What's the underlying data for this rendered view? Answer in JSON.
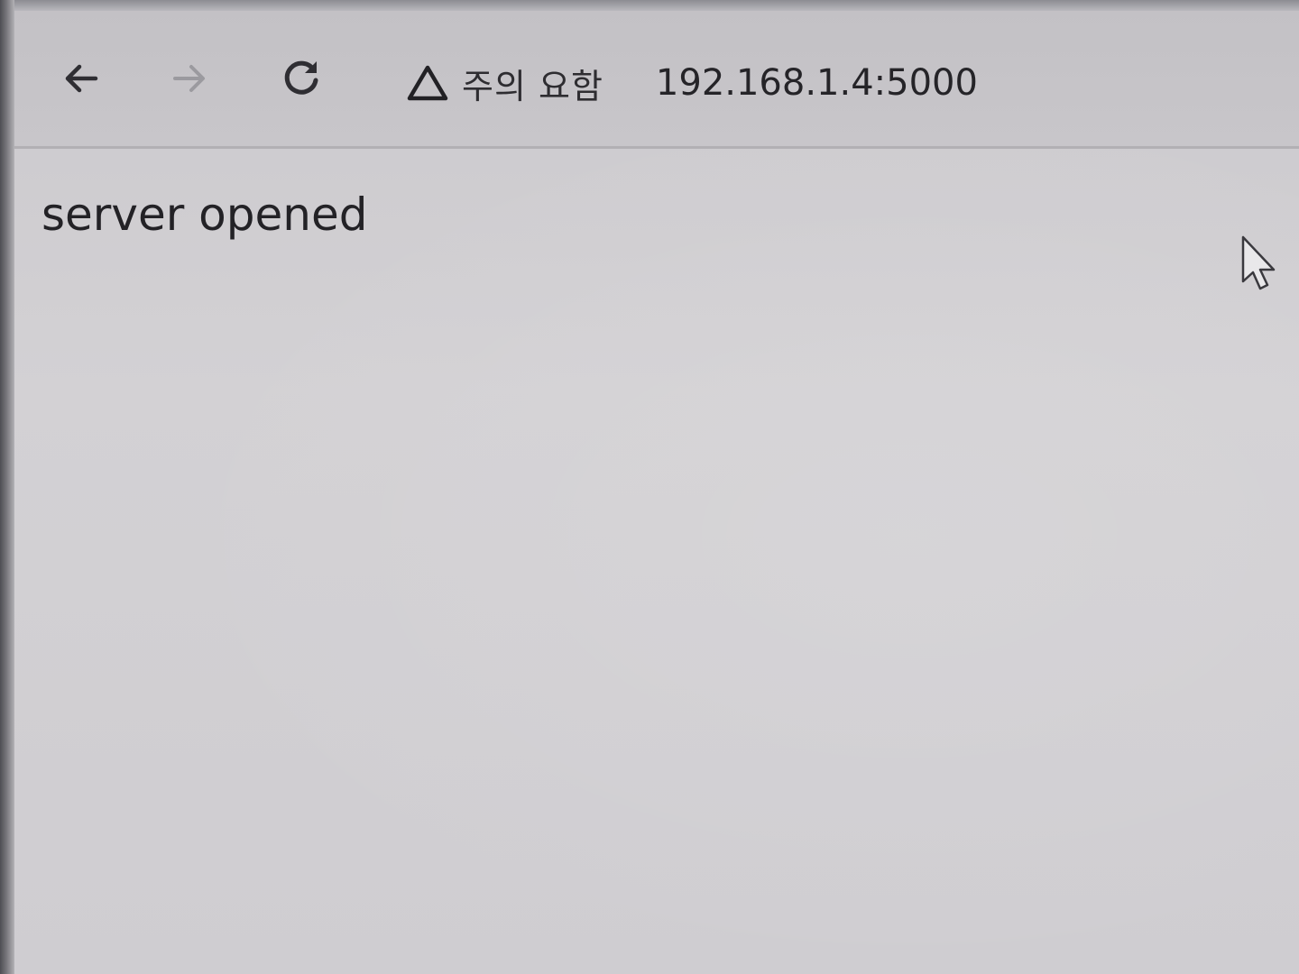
{
  "toolbar": {
    "back_icon": "arrow-left-icon",
    "forward_icon": "arrow-right-icon",
    "reload_icon": "reload-icon",
    "security_icon": "warning-triangle-icon",
    "security_label": "주의 요함",
    "url": "192.168.1.4:5000"
  },
  "page": {
    "body_text": "server opened"
  },
  "colors": {
    "page_background": "#cfcdd2",
    "toolbar_background": "#c5c3c7",
    "text": "#232226",
    "disabled_icon": "#9b9a9f"
  },
  "cursor": {
    "icon": "mouse-pointer-icon"
  }
}
